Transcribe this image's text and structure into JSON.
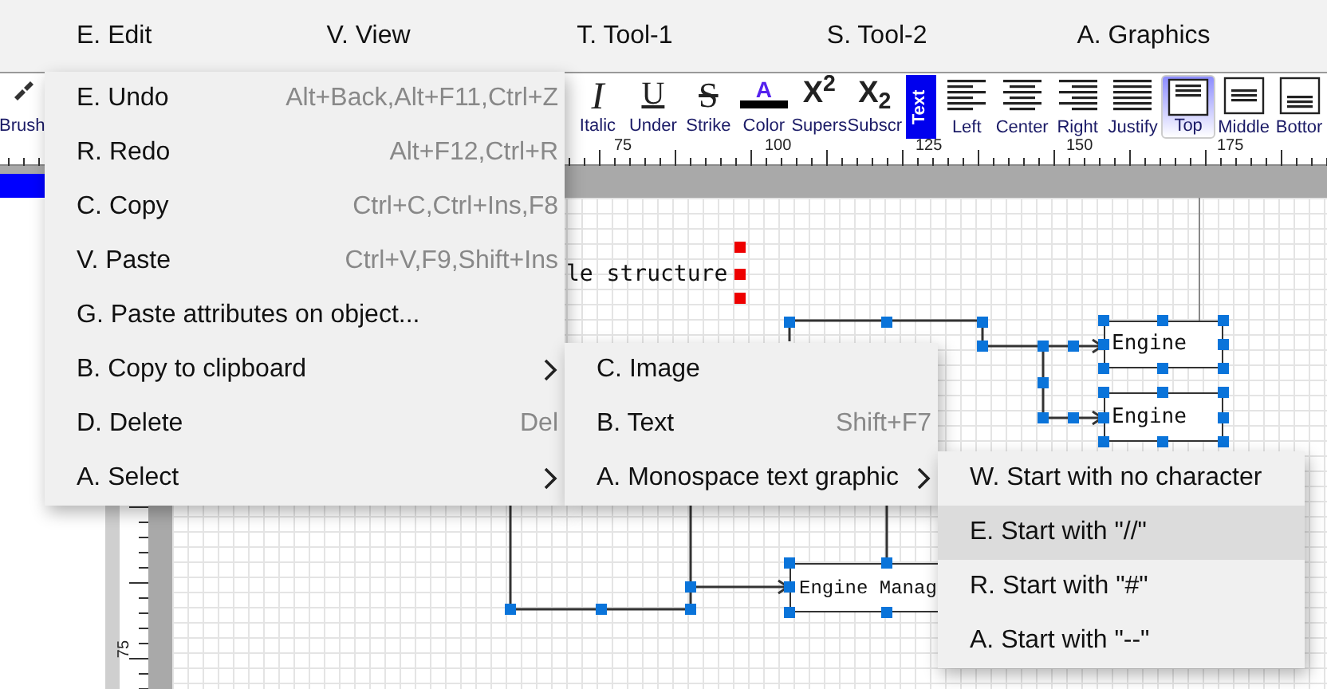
{
  "menu_bar": [
    {
      "label": "E. Edit"
    },
    {
      "label": "V. View"
    },
    {
      "label": "T. Tool-1"
    },
    {
      "label": "S. Tool-2"
    },
    {
      "label": "A. Graphics"
    }
  ],
  "toolbar": {
    "brush_label": "Brush",
    "items": [
      {
        "kind": "glyph",
        "glyph": "I",
        "label": "Italic"
      },
      {
        "kind": "glyph",
        "glyph": "U",
        "label": "Under"
      },
      {
        "kind": "glyph",
        "glyph": "S",
        "label": "Strike"
      },
      {
        "kind": "color",
        "glyph": "A",
        "label": "Color",
        "color": "#000000"
      },
      {
        "kind": "glyph",
        "glyph": "X$^{2}$",
        "label": "Supers"
      },
      {
        "kind": "glyph",
        "glyph": "X$_{2}$",
        "label": "Subscr"
      },
      {
        "kind": "tab",
        "label": "Text"
      },
      {
        "kind": "align",
        "label": "Left",
        "selected": false
      },
      {
        "kind": "align",
        "label": "Center",
        "selected": false
      },
      {
        "kind": "align",
        "label": "Right",
        "selected": false
      },
      {
        "kind": "align",
        "label": "Justify",
        "selected": false
      },
      {
        "kind": "align",
        "label": "Top",
        "selected": true
      },
      {
        "kind": "align",
        "label": "Middle",
        "selected": false
      },
      {
        "kind": "align",
        "label": "Bottor",
        "selected": false
      }
    ]
  },
  "ruler": {
    "labels": [
      "75",
      "100",
      "125",
      "150",
      "175"
    ]
  },
  "vertical_ruler": {
    "labels": [
      "75"
    ]
  },
  "canvas": {
    "caption": "le structure",
    "nodes": [
      {
        "label": "Engine"
      },
      {
        "label": "Engine"
      },
      {
        "label": "Engine Manag"
      }
    ]
  },
  "edit_menu": {
    "items": [
      {
        "label": "E. Undo",
        "shortcut": "Alt+Back,Alt+F11,Ctrl+Z"
      },
      {
        "label": "R. Redo",
        "shortcut": "Alt+F12,Ctrl+R"
      },
      {
        "label": "C. Copy",
        "shortcut": "Ctrl+C,Ctrl+Ins,F8"
      },
      {
        "label": "V. Paste",
        "shortcut": "Ctrl+V,F9,Shift+Ins"
      },
      {
        "label": "G. Paste attributes on object..."
      },
      {
        "label": "B. Copy to clipboard",
        "submenu": true
      },
      {
        "label": "D. Delete",
        "shortcut": "Del"
      },
      {
        "label": "A. Select",
        "submenu": true
      }
    ]
  },
  "copy_submenu": {
    "items": [
      {
        "label": "C. Image"
      },
      {
        "label": "B. Text",
        "shortcut": "Shift+F7"
      },
      {
        "label": "A. Monospace text graphic",
        "submenu": true
      }
    ]
  },
  "text_graphic_submenu": {
    "items": [
      {
        "label": "W. Start with no character",
        "selected": false
      },
      {
        "label": "E. Start with \"//\"",
        "selected": true
      },
      {
        "label": "R. Start with \"#\"",
        "selected": false
      },
      {
        "label": "A. Start with \"--\"",
        "selected": false
      }
    ]
  }
}
